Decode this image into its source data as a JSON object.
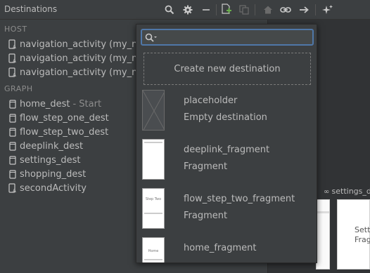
{
  "panel": {
    "title": "Destinations"
  },
  "toolbar": {
    "icons": [
      "search-icon",
      "gear-icon",
      "minimize-icon",
      "new-destination-icon",
      "copy-icon",
      "home-icon",
      "link-icon",
      "arrow-icon",
      "auto-arrange-icon"
    ]
  },
  "host": {
    "header": "HOST",
    "items": [
      {
        "label": "navigation_activity (my_nav"
      },
      {
        "label": "navigation_activity (my_nav"
      },
      {
        "label": "navigation_activity (my_nav"
      }
    ]
  },
  "graph": {
    "header": "GRAPH",
    "items": [
      {
        "label": "home_dest",
        "sub": "- Start",
        "icon": "fragment-icon"
      },
      {
        "label": "flow_step_one_dest",
        "sub": "",
        "icon": "fragment-icon"
      },
      {
        "label": "flow_step_two_dest",
        "sub": "",
        "icon": "fragment-icon"
      },
      {
        "label": "deeplink_dest",
        "sub": "",
        "icon": "fragment-icon"
      },
      {
        "label": "settings_dest",
        "sub": "",
        "icon": "fragment-icon"
      },
      {
        "label": "shopping_dest",
        "sub": "",
        "icon": "fragment-icon"
      },
      {
        "label": "secondActivity",
        "sub": "",
        "icon": "activity-icon"
      }
    ]
  },
  "canvas": {
    "settings_label": "settings_d",
    "card_text_1": "Setti",
    "card_text_2": "Fragn"
  },
  "popup": {
    "search": {
      "value": "",
      "placeholder": ""
    },
    "create_new": "Create new destination",
    "destinations": [
      {
        "name": "placeholder",
        "type": "Empty destination",
        "thumb_text": ""
      },
      {
        "name": "deeplink_fragment",
        "type": "Fragment",
        "thumb_text": ""
      },
      {
        "name": "flow_step_two_fragment",
        "type": "Fragment",
        "thumb_text": "Step Two"
      },
      {
        "name": "home_fragment",
        "type": "",
        "thumb_text": "Home"
      }
    ]
  },
  "colors": {
    "accent": "#4f77a8",
    "new_icon": "#6ab04c"
  }
}
